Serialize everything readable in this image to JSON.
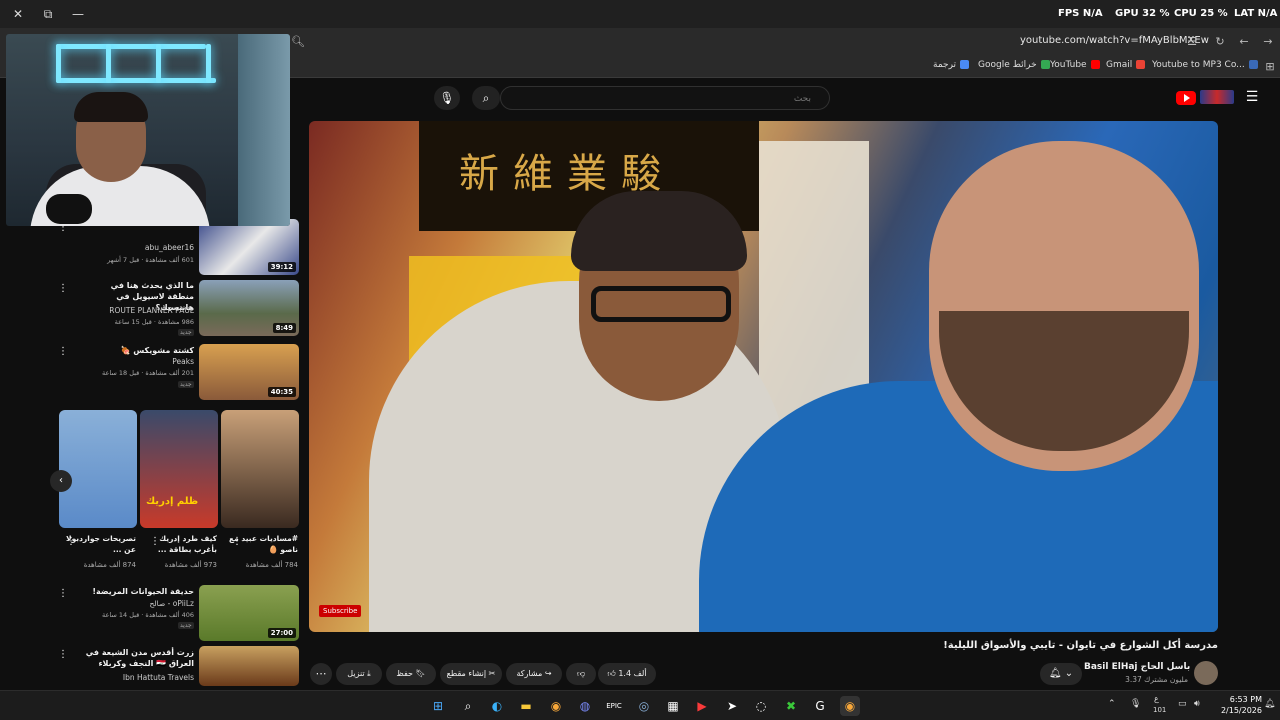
{
  "window": {
    "close": "✕",
    "restore": "⧉",
    "minimize": "—"
  },
  "overlay_stats": {
    "fps_label": "FPS",
    "fps_value": "N/A",
    "gpu_label": "GPU",
    "gpu_value": "32 %",
    "cpu_label": "CPU",
    "cpu_value": "25 %",
    "lat_label": "LAT",
    "lat_value": "N/A"
  },
  "address_bar": {
    "url": "youtube.com/watch?v=fMAyBlbMXEw"
  },
  "bookmarks": [
    {
      "label": "ترجمة",
      "color": "#4a8af4"
    },
    {
      "label": "Google خرائط",
      "color": "#34a853"
    },
    {
      "label": "YouTube",
      "color": "#ff0000"
    },
    {
      "label": "Gmail",
      "color": "#ea4335"
    },
    {
      "label": "Youtube to MP3 Co...",
      "color": "#3a6ab8"
    }
  ],
  "search": {
    "placeholder": "بحث"
  },
  "video": {
    "sign_text": "新維業駿",
    "subscribe_watermark": "Subscribe",
    "title": "مدرسة أكل الشوارع في تايوان - تايبي والأسواق الليلية!",
    "channel_name": "Basil ElHaj باسل الحاج",
    "subscribers": "3.37 مليون مشترك",
    "likes": "1.4 ألف",
    "share": "مشاركة",
    "clip": "إنشاء مقطع",
    "save": "حفظ",
    "download": "تنزيل"
  },
  "sidebar_videos": [
    {
      "title": "",
      "channel": "abu_abeer16",
      "meta": "601 ألف مشاهدة · قبل 7 أشهر",
      "duration": "39:12",
      "thumb_color": "#3a4a8a"
    },
    {
      "title": "ما الذي يحدث هنا في منطقة لاسيويل في هانتسيك؟",
      "channel": "ROUTE PLANNER PAUL",
      "meta": "986 مشاهدة · قبل 15 ساعة",
      "duration": "8:49",
      "thumb_color": "#6a7a5a",
      "new": "جديد"
    },
    {
      "title": "كشتة مشويكس 🍖",
      "channel": "Peaks",
      "meta": "201 ألف مشاهدة · قبل 18 ساعة",
      "duration": "40:35",
      "thumb_color": "#c88a3a",
      "new": "جديد"
    },
    {
      "title": "حديقة الحيوانات المريضة!",
      "channel": "oPiiLz - صالح",
      "meta": "406 ألف مشاهدة · قبل 14 ساعة",
      "duration": "27:00",
      "thumb_color": "#7a8a3a",
      "new": "جديد"
    },
    {
      "title": "زرت أقدس مدن الشيعة في العراق 🇮🇶 النجف وكربلاء",
      "channel": "Ibn Hattuta Travels",
      "meta": "",
      "duration": "",
      "thumb_color": "#8a4a2a"
    }
  ],
  "shorts": [
    {
      "title": "#مساديات عبيد مع ناصو 🥚",
      "views": "784 ألف مشاهدة",
      "color": "#6a5a4a"
    },
    {
      "title": "كيف طرد إدريك بأغرب بطاقة ...",
      "views": "973 ألف مشاهدة",
      "color": "#c83a2a",
      "overlay": "ظلم إدريك"
    },
    {
      "title": "تصريحات جواردبولا عن ...",
      "views": "874 ألف مشاهدة",
      "color": "#5a8ac8"
    }
  ],
  "taskbar": {
    "time": "6:53 PM",
    "date": "2/15/2026",
    "lang": "ع",
    "lang_sub": "101"
  }
}
